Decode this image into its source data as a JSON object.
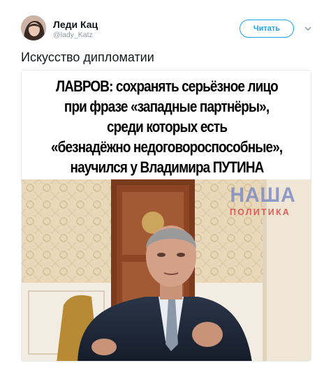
{
  "user": {
    "display_name": "Леди Кац",
    "handle": "@lady_Katz"
  },
  "follow_label": "Читать",
  "tweet_text": "Искусство дипломатии",
  "media": {
    "headline_lines": [
      "ЛАВРОВ: сохранять серьёзное лицо",
      "при фразе «западные партнёры»,",
      "среди которых есть",
      "«безнадёжно недоговороспособные»,",
      "научился у Владимира ПУТИНА"
    ],
    "watermark_top": "НАША",
    "watermark_bottom": "ПОЛИТИКА"
  },
  "icons": {
    "caret": "chevron-down-icon"
  }
}
